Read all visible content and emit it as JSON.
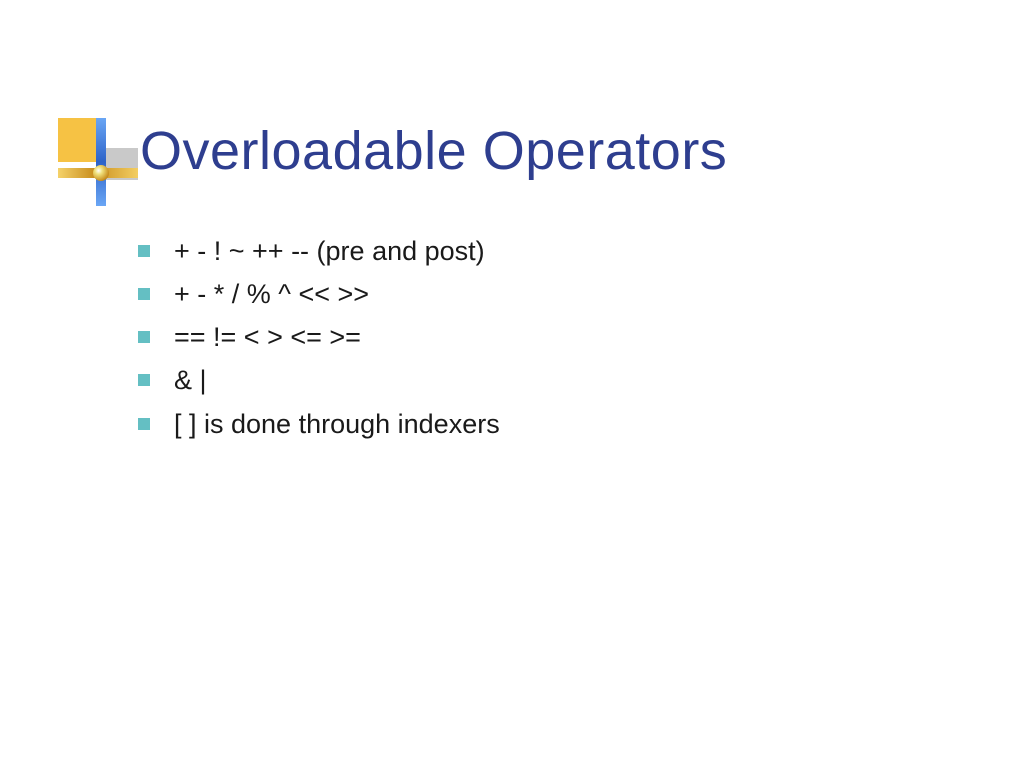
{
  "title": "Overloadable Operators",
  "bullets": [
    "+  -  !  ~  ++  -- (pre and post)",
    "+  -  *  /  %  ^  <<  >>",
    "== !=  <  >  <=  >=",
    "&  |",
    "[ ] is done through indexers"
  ]
}
